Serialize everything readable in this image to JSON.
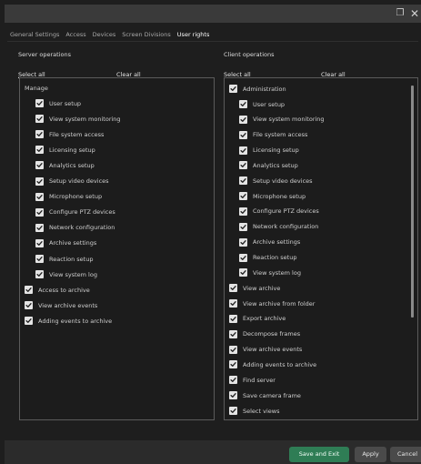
{
  "window": {
    "restore_glyph": "❐",
    "close_glyph": "✕"
  },
  "tabs": [
    {
      "label": "General Settings",
      "active": false
    },
    {
      "label": "Access",
      "active": false
    },
    {
      "label": "Devices",
      "active": false
    },
    {
      "label": "Screen Divisions",
      "active": false
    },
    {
      "label": "User rights",
      "active": true
    }
  ],
  "server": {
    "heading": "Server operations",
    "select_all": "Select all",
    "clear_all": "Clear all",
    "group_label": "Manage",
    "items": [
      "User setup",
      "View system monitoring",
      "File system access",
      "Licensing setup",
      "Analytics setup",
      "Setup video devices",
      "Microphone setup",
      "Configure PTZ devices",
      "Network configuration",
      "Archive settings",
      "Reaction setup",
      "View system log"
    ],
    "top_items": [
      "Access to archive",
      "View archive events",
      "Adding events to archive"
    ]
  },
  "client": {
    "heading": "Client operations",
    "select_all": "Select all",
    "clear_all": "Clear all",
    "group_label": "Administration",
    "items": [
      "User setup",
      "View system monitoring",
      "File system access",
      "Licensing setup",
      "Analytics setup",
      "Setup video devices",
      "Microphone setup",
      "Configure PTZ devices",
      "Network configuration",
      "Archive settings",
      "Reaction setup",
      "View system log"
    ],
    "top_items": [
      "View archive",
      "View archive from folder",
      "Export archive",
      "Decompose frames",
      "View archive events",
      "Adding events to archive",
      "Find server",
      "Save camera frame",
      "Select views"
    ]
  },
  "footer": {
    "save_exit": "Save and Exit",
    "apply": "Apply",
    "cancel": "Cancel"
  },
  "colors": {
    "accent_button": "#2f7d55",
    "checkbox": "#e4e4e4",
    "check_mark": "#1a1a1a"
  },
  "icons": {
    "check": "check-icon",
    "close": "close-icon",
    "restore": "restore-icon"
  }
}
